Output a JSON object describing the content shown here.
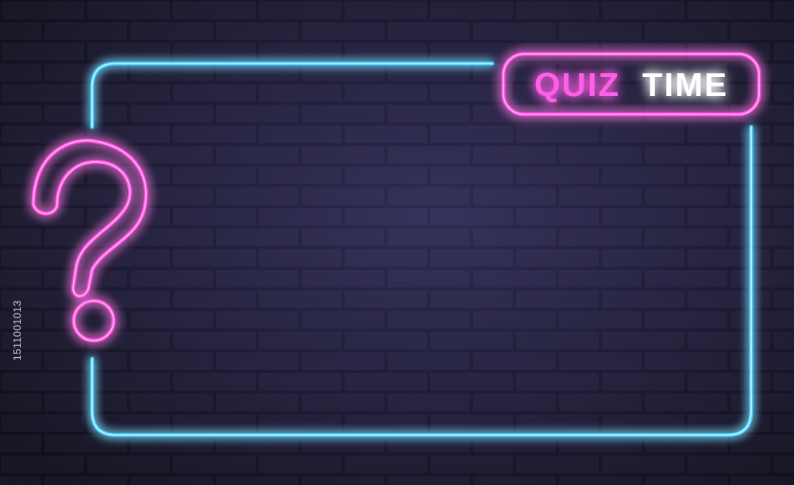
{
  "sign": {
    "word1": "QUIZ",
    "word2": "TIME",
    "symbol": "question-mark",
    "colors": {
      "wall": "#1f1d33",
      "mortar": "#0f0e1a",
      "cyan_neon": "#3fd0ff",
      "pink_neon": "#ff4fe0",
      "pink_core": "#ffb6f4",
      "time_text": "#ffffff"
    }
  },
  "watermark": {
    "side_id": "1511001013"
  }
}
